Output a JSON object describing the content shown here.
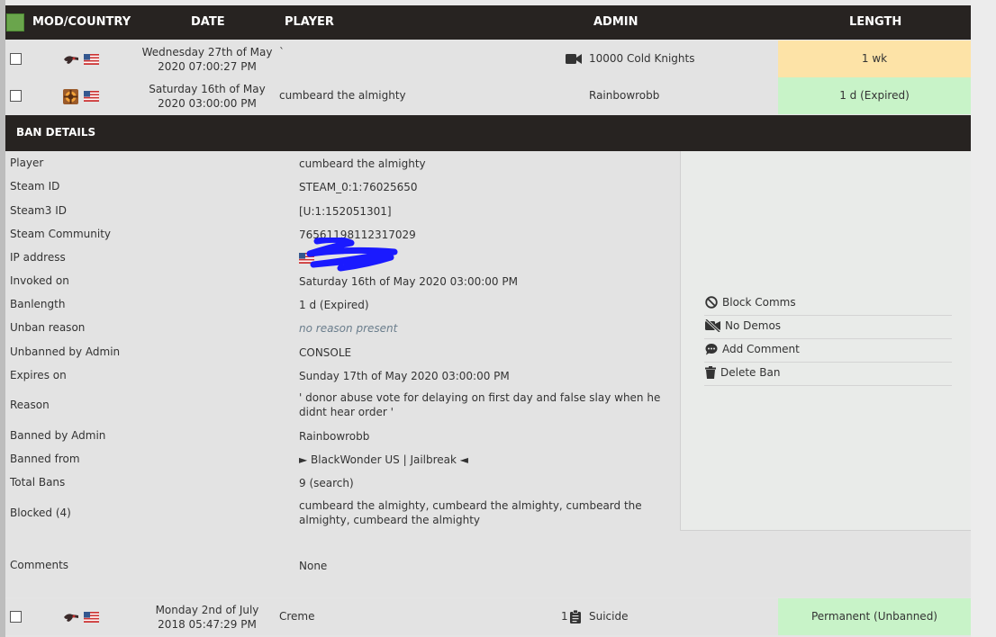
{
  "header": {
    "mod_country": "MOD/COUNTRY",
    "date": "DATE",
    "player": "PLAYER",
    "admin": "ADMIN",
    "length": "LENGTH"
  },
  "rows": [
    {
      "date_line1": "Wednesday 27th of May",
      "date_line2": "2020 07:00:27 PM",
      "player": "`",
      "admin": "10000 Cold Knights",
      "length": "1 wk",
      "length_color": "#fde3a7",
      "icons": [
        "gun-icon",
        "us-flag-icon",
        "video-camera-icon"
      ]
    },
    {
      "date_line1": "Saturday 16th of May",
      "date_line2": "2020 03:00:00 PM",
      "player": "cumbeard the almighty",
      "admin": "Rainbowrobb",
      "length": "1 d (Expired)",
      "length_color": "#c8f3c8",
      "icons": [
        "tf2-icon",
        "us-flag-icon"
      ]
    },
    {
      "date_line1": "Monday 2nd of July",
      "date_line2": "2018 05:47:29 PM",
      "player": "Creme",
      "admin": "Suicide",
      "admin_count": "1",
      "length": "Permanent (Unbanned)",
      "length_color": "#c8f3c8",
      "icons": [
        "gun-icon",
        "us-flag-icon",
        "clipboard-icon"
      ]
    }
  ],
  "details": {
    "title": "BAN DETAILS",
    "fields": [
      {
        "label": "Player",
        "value": "cumbeard the almighty"
      },
      {
        "label": "Steam ID",
        "value": "STEAM_0:1:76025650"
      },
      {
        "label": "Steam3 ID",
        "value": "[U:1:152051301]"
      },
      {
        "label": "Steam Community",
        "value": "76561198112317029"
      },
      {
        "label": "IP address",
        "value": ""
      },
      {
        "label": "Invoked on",
        "value": "Saturday 16th of May 2020 03:00:00 PM"
      },
      {
        "label": "Banlength",
        "value": "1 d (Expired)"
      },
      {
        "label": "Unban reason",
        "value": "no reason present"
      },
      {
        "label": "Unbanned by Admin",
        "value": "CONSOLE"
      },
      {
        "label": "Expires on",
        "value": "Sunday 17th of May 2020 03:00:00 PM"
      },
      {
        "label": "Reason",
        "value": "' donor abuse vote for delaying on first day and false slay when he didnt hear order '"
      },
      {
        "label": "Banned by Admin",
        "value": "Rainbowrobb"
      },
      {
        "label": "Banned from",
        "value": "► BlackWonder US | Jailbreak ◄"
      },
      {
        "label": "Total Bans",
        "value": "9 (search)"
      },
      {
        "label": "Blocked (4)",
        "value": "cumbeard the almighty, cumbeard the almighty, cumbeard the almighty, cumbeard the almighty"
      },
      {
        "label": "Comments",
        "value": "None"
      }
    ],
    "actions": [
      {
        "label": "Block Comms",
        "icon": "block-icon"
      },
      {
        "label": "No Demos",
        "icon": "no-video-icon"
      },
      {
        "label": "Add Comment",
        "icon": "comment-icon"
      },
      {
        "label": "Delete Ban",
        "icon": "trash-icon"
      }
    ]
  },
  "colors": {
    "header_bg": "#272321",
    "row_bg": "#e3e3e3",
    "length_warning": "#fde3a7",
    "length_ok": "#c8f3c8",
    "select_all_green": "#6aa54c",
    "redaction": "#1a1aff"
  }
}
